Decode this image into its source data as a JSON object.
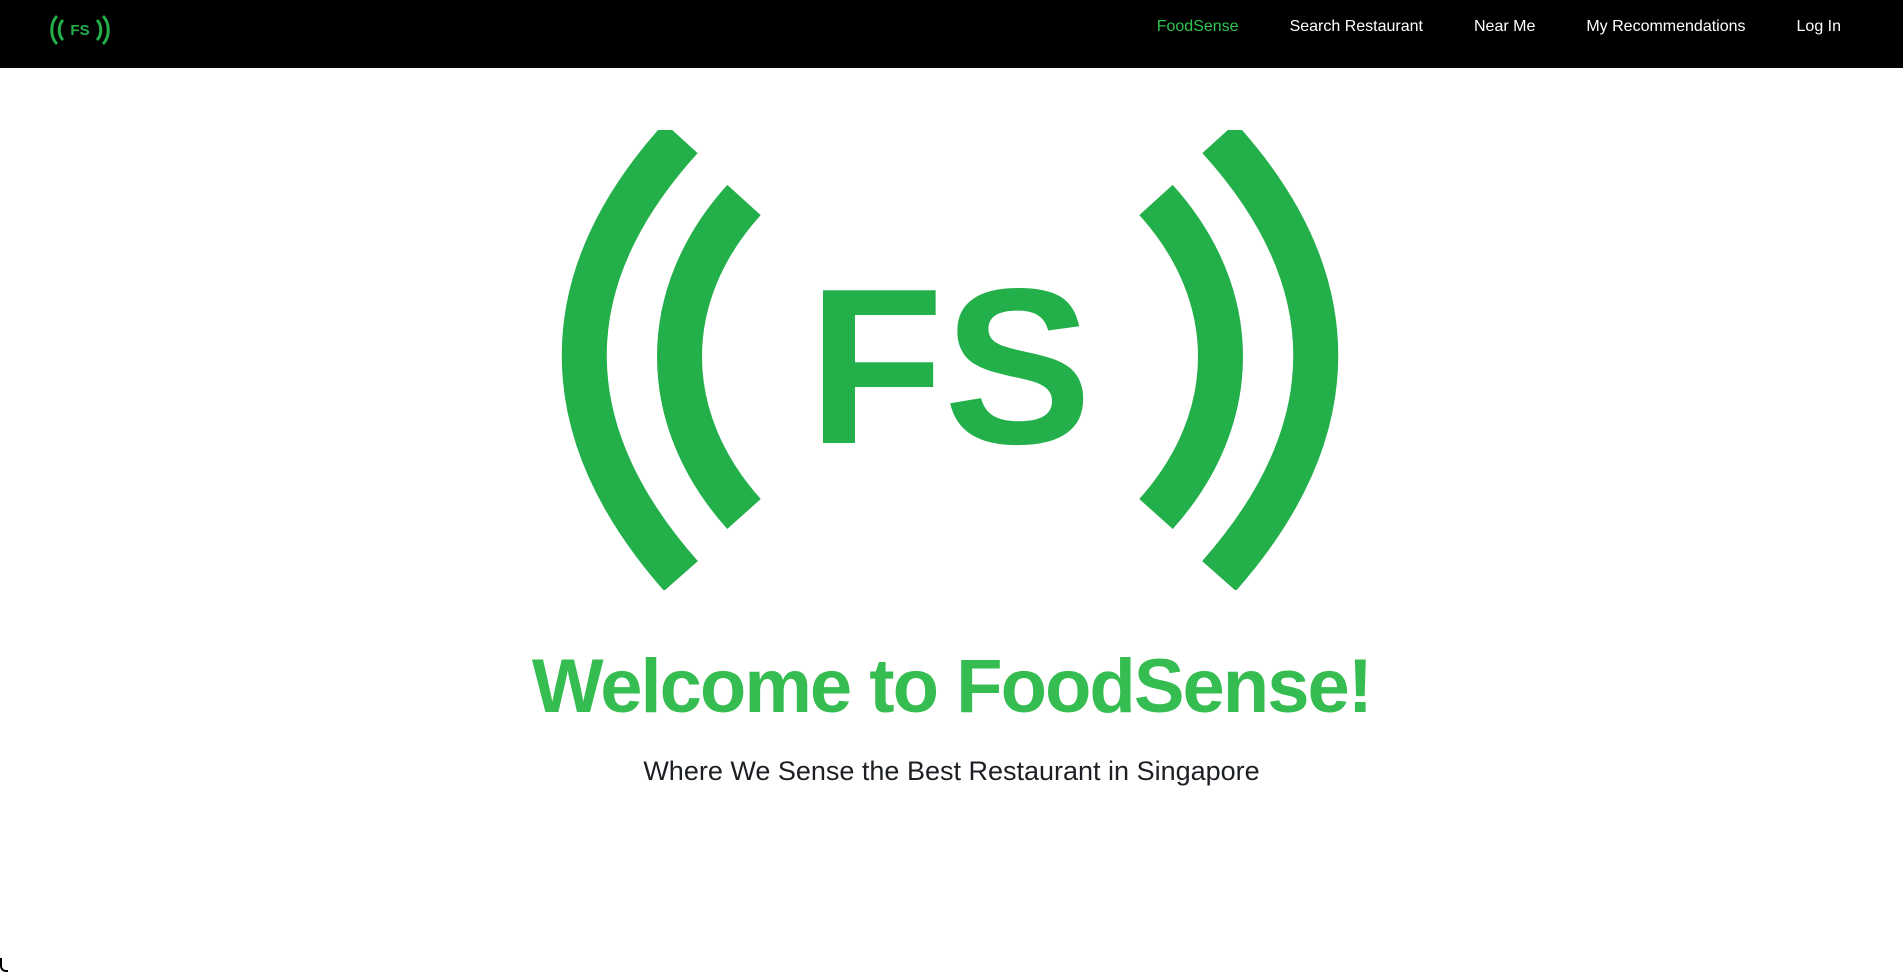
{
  "nav": {
    "logo_text": "FS",
    "links": [
      {
        "label": "FoodSense",
        "active": true
      },
      {
        "label": "Search Restaurant",
        "active": false
      },
      {
        "label": "Near Me",
        "active": false
      },
      {
        "label": "My Recommendations",
        "active": false
      },
      {
        "label": "Log In",
        "active": false
      }
    ]
  },
  "hero": {
    "logo_text": "FS",
    "title": "Welcome to FoodSense!",
    "subtitle": "Where We Sense the Best Restaurant in Singapore"
  },
  "colors": {
    "brand_green": "#23b04a",
    "title_green": "#36bd51",
    "nav_active": "#2ec44f",
    "nav_bg": "#000000",
    "text_dark": "#1c1f24"
  }
}
